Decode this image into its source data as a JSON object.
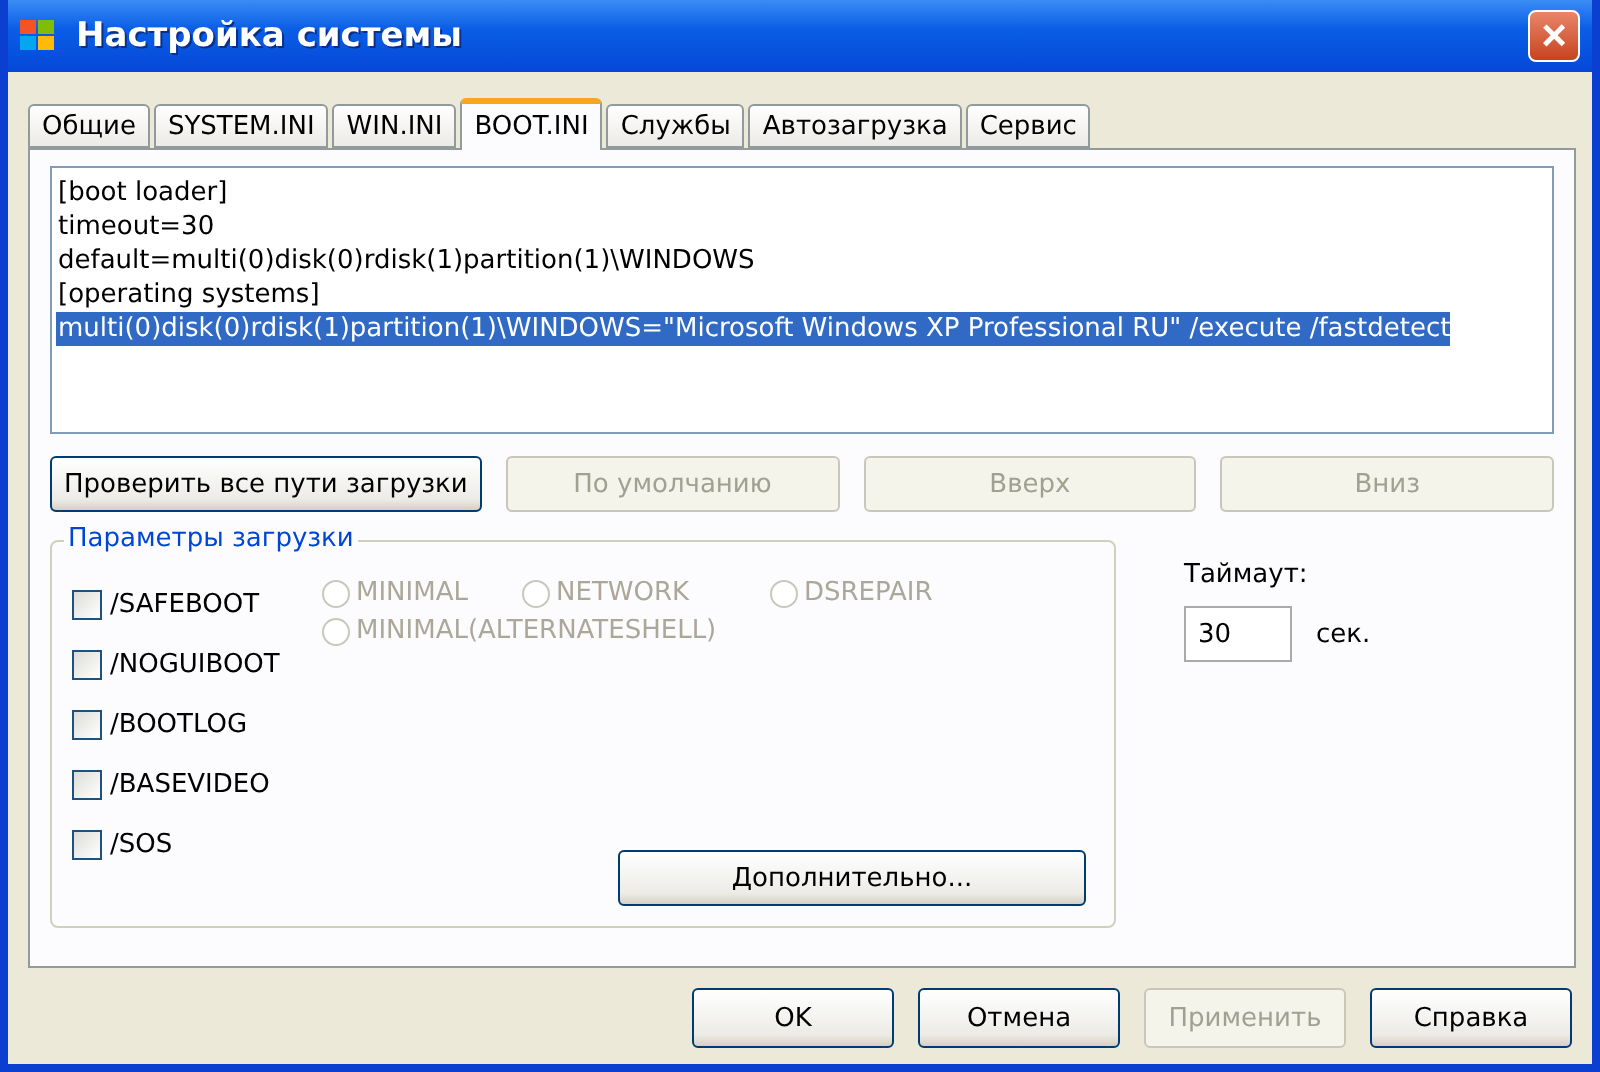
{
  "window": {
    "title": "Настройка системы",
    "close": "×"
  },
  "tabs": [
    {
      "label": "Общие",
      "selected": false
    },
    {
      "label": "SYSTEM.INI",
      "selected": false
    },
    {
      "label": "WIN.INI",
      "selected": false
    },
    {
      "label": "BOOT.INI",
      "selected": true
    },
    {
      "label": "Службы",
      "selected": false
    },
    {
      "label": "Автозагрузка",
      "selected": false
    },
    {
      "label": "Сервис",
      "selected": false
    }
  ],
  "boot_lines": [
    {
      "text": "[boot loader]",
      "selected": false
    },
    {
      "text": "timeout=30",
      "selected": false
    },
    {
      "text": "default=multi(0)disk(0)rdisk(1)partition(1)\\WINDOWS",
      "selected": false
    },
    {
      "text": "[operating systems]",
      "selected": false
    },
    {
      "text": "multi(0)disk(0)rdisk(1)partition(1)\\WINDOWS=\"Microsoft Windows XP Professional RU\" /execute /fastdetect",
      "selected": true
    }
  ],
  "list_buttons": [
    {
      "label": "Проверить все пути загрузки",
      "disabled": false
    },
    {
      "label": "По умолчанию",
      "disabled": true
    },
    {
      "label": "Вверх",
      "disabled": true
    },
    {
      "label": "Вниз",
      "disabled": true
    }
  ],
  "boot_options": {
    "title": "Параметры загрузки",
    "checkboxes": [
      {
        "label": "/SAFEBOOT",
        "checked": false
      },
      {
        "label": "/NOGUIBOOT",
        "checked": false
      },
      {
        "label": "/BOOTLOG",
        "checked": false
      },
      {
        "label": "/BASEVIDEO",
        "checked": false
      },
      {
        "label": "/SOS",
        "checked": false
      }
    ],
    "radios": [
      {
        "label": "MINIMAL",
        "selected": false,
        "disabled": true
      },
      {
        "label": "NETWORK",
        "selected": false,
        "disabled": true
      },
      {
        "label": "DSREPAIR",
        "selected": false,
        "disabled": true
      },
      {
        "label": "MINIMAL(ALTERNATESHELL)",
        "selected": false,
        "disabled": true
      }
    ],
    "advanced_button": "Дополнительно..."
  },
  "timeout": {
    "label": "Таймаут:",
    "value": "30",
    "unit": "сек."
  },
  "buttons": [
    {
      "label": "OK",
      "disabled": false
    },
    {
      "label": "Отмена",
      "disabled": false
    },
    {
      "label": "Применить",
      "disabled": true
    },
    {
      "label": "Справка",
      "disabled": false
    }
  ]
}
